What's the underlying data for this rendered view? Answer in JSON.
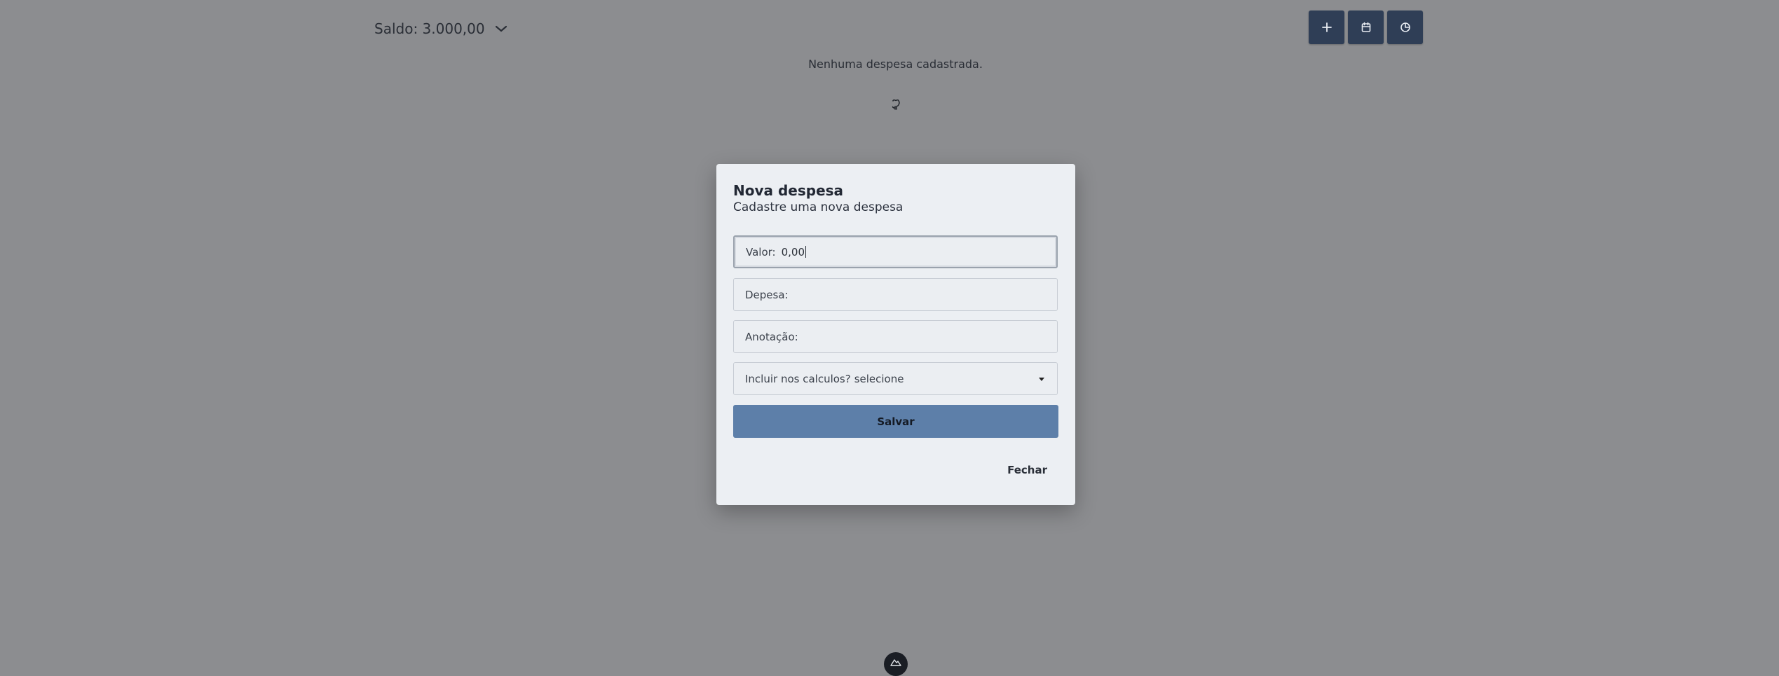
{
  "header": {
    "balance_label": "Saldo: 3.000,00",
    "actions": [
      {
        "icon": "plus-icon"
      },
      {
        "icon": "calendar-icon"
      },
      {
        "icon": "pie-chart-icon"
      }
    ]
  },
  "main": {
    "empty_message": "Nenhuma despesa cadastrada."
  },
  "modal": {
    "title": "Nova despesa",
    "subtitle": "Cadastre uma nova despesa",
    "fields": {
      "valor": {
        "label": "Valor:",
        "value": "0,00"
      },
      "despesa": {
        "label": "Depesa:"
      },
      "anotacao": {
        "label": "Anotação:"
      },
      "incluir": {
        "label": "Incluir nos calculos?",
        "selected": "selecione"
      }
    },
    "save_label": "Salvar",
    "close_label": "Fechar"
  },
  "colors": {
    "background": "#8c8d90",
    "action_button": "#2f3e56",
    "primary": "#5d7fa9",
    "modal": "#eceff3"
  }
}
